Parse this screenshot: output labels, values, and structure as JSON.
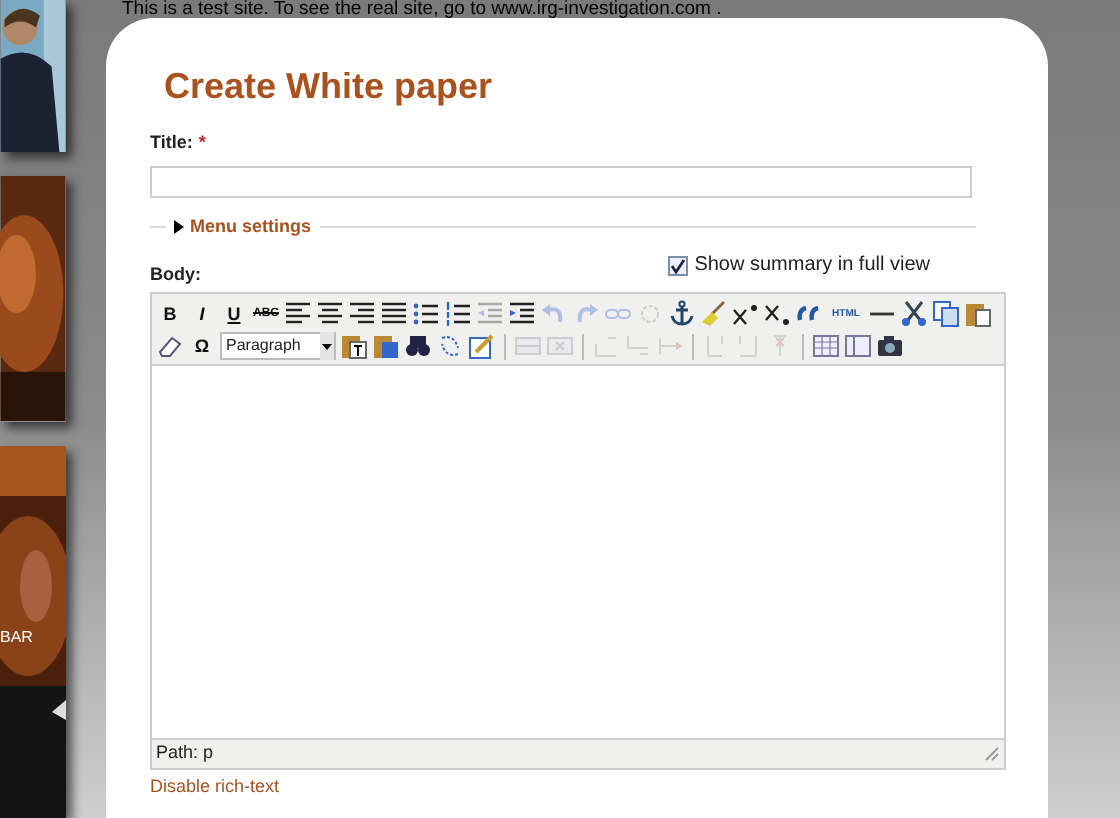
{
  "notice": "This is a test site. To see the real site, go to www.irg-investigation.com .",
  "sidebar": {
    "caption": "BAR"
  },
  "form": {
    "heading": "Create White paper",
    "title_field": {
      "label": "Title:",
      "required_mark": "*"
    },
    "menu_settings": {
      "label": "Menu settings",
      "expanded": false
    },
    "body": {
      "label": "Body:",
      "summary_toggle": {
        "label": "Show summary in full view",
        "checked": true
      },
      "toolbar_rows": [
        [
          {
            "kind": "text",
            "label": "B",
            "disabled": false
          },
          {
            "kind": "text",
            "label": "I",
            "disabled": false
          },
          {
            "kind": "text",
            "label": "U",
            "disabled": false
          },
          {
            "kind": "text",
            "label": "ABC",
            "disabled": false
          },
          {
            "kind": "icon",
            "disabled": false
          },
          {
            "kind": "icon",
            "disabled": false
          },
          {
            "kind": "icon",
            "disabled": false
          },
          {
            "kind": "icon",
            "disabled": false
          },
          {
            "kind": "icon",
            "disabled": false
          },
          {
            "kind": "icon",
            "disabled": false
          },
          {
            "kind": "icon",
            "disabled": true
          },
          {
            "kind": "icon",
            "disabled": false
          },
          {
            "kind": "icon",
            "disabled": true
          },
          {
            "kind": "icon",
            "disabled": true
          },
          {
            "kind": "icon",
            "disabled": true
          },
          {
            "kind": "icon",
            "disabled": true
          },
          {
            "kind": "icon",
            "disabled": false
          },
          {
            "kind": "icon",
            "disabled": false
          },
          {
            "kind": "icon",
            "disabled": false
          },
          {
            "kind": "icon",
            "disabled": false
          },
          {
            "kind": "icon",
            "disabled": false
          },
          {
            "kind": "text",
            "label": "HTML",
            "disabled": false
          },
          {
            "kind": "icon",
            "disabled": false
          },
          {
            "kind": "icon",
            "disabled": false
          },
          {
            "kind": "icon",
            "disabled": false
          },
          {
            "kind": "icon",
            "disabled": false
          }
        ],
        [
          {
            "kind": "icon",
            "disabled": false
          },
          {
            "kind": "text",
            "label": "Ω",
            "disabled": false
          },
          {
            "kind": "select",
            "label": "Paragraph",
            "disabled": false
          },
          {
            "kind": "icon",
            "disabled": false
          },
          {
            "kind": "icon",
            "disabled": false
          },
          {
            "kind": "icon",
            "disabled": false
          },
          {
            "kind": "icon",
            "disabled": false
          },
          {
            "kind": "icon",
            "disabled": false
          },
          {
            "kind": "separator"
          },
          {
            "kind": "icon",
            "disabled": true
          },
          {
            "kind": "icon",
            "disabled": true
          },
          {
            "kind": "separator"
          },
          {
            "kind": "icon",
            "disabled": true
          },
          {
            "kind": "icon",
            "disabled": true
          },
          {
            "kind": "icon",
            "disabled": true
          },
          {
            "kind": "separator"
          },
          {
            "kind": "icon",
            "disabled": true
          },
          {
            "kind": "icon",
            "disabled": true
          },
          {
            "kind": "icon",
            "disabled": true
          },
          {
            "kind": "separator"
          },
          {
            "kind": "icon",
            "disabled": false
          },
          {
            "kind": "icon",
            "disabled": false
          },
          {
            "kind": "icon",
            "disabled": false
          }
        ]
      ],
      "path": "Path: p",
      "disable_link": "Disable rich-text"
    }
  }
}
